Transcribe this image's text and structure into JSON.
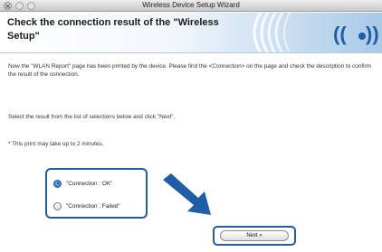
{
  "window": {
    "title": "Wireless Device Setup Wizard"
  },
  "header": {
    "title": "Check the connection result of the \"Wireless Setup\"",
    "logo_icon": "wireless-signal-icon",
    "accent_color": "#1f5ea6"
  },
  "content": {
    "instruction": "Now the \"WLAN Report\" page has been printed by the device. Please find the <Connection> on the page and check the description to confirm the result of the connection.",
    "select_prompt": "Select the result from the list of selections below and click \"Next\".",
    "note": "* This print may take up to 2 minutes."
  },
  "options": [
    {
      "label": "\"Connection : OK\"",
      "selected": true
    },
    {
      "label": "\"Connection : Failed\"",
      "selected": false
    }
  ],
  "buttons": {
    "next_label": "Next »"
  }
}
